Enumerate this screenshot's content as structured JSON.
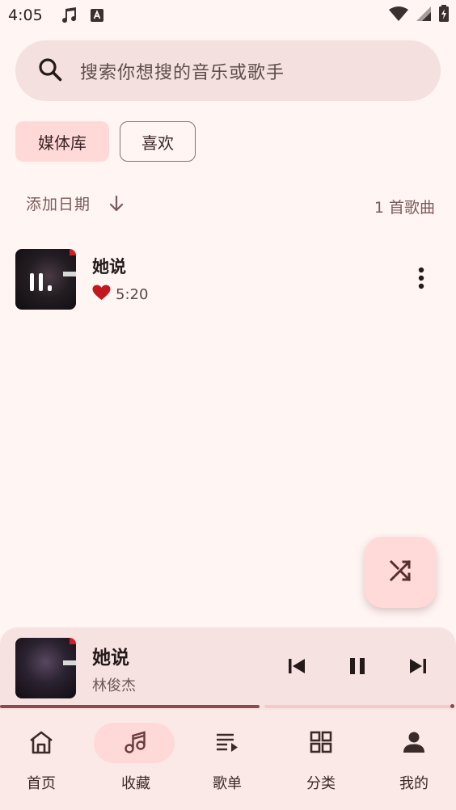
{
  "status_bar": {
    "time": "4:05"
  },
  "search": {
    "placeholder": "搜索你想搜的音乐或歌手"
  },
  "chips": [
    {
      "label": "媒体库",
      "selected": true
    },
    {
      "label": "喜欢",
      "selected": false
    }
  ],
  "sort": {
    "label": "添加日期",
    "count": "1 首歌曲"
  },
  "tracks": [
    {
      "title": "她说",
      "duration": "5:20",
      "favorited": true
    }
  ],
  "player": {
    "title": "她说",
    "artist": "林俊杰",
    "progress": 0.57
  },
  "nav": {
    "items": [
      {
        "label": "首页",
        "icon": "home-icon",
        "active": false
      },
      {
        "label": "收藏",
        "icon": "music-note-icon",
        "active": true
      },
      {
        "label": "歌单",
        "icon": "playlist-icon",
        "active": false
      },
      {
        "label": "分类",
        "icon": "grid-icon",
        "active": false
      },
      {
        "label": "我的",
        "icon": "person-icon",
        "active": false
      }
    ]
  },
  "colors": {
    "accent": "#8c4a4c",
    "chip_selected": "#ffd9d8",
    "heart": "#c0181e",
    "background": "#fff5f3"
  }
}
